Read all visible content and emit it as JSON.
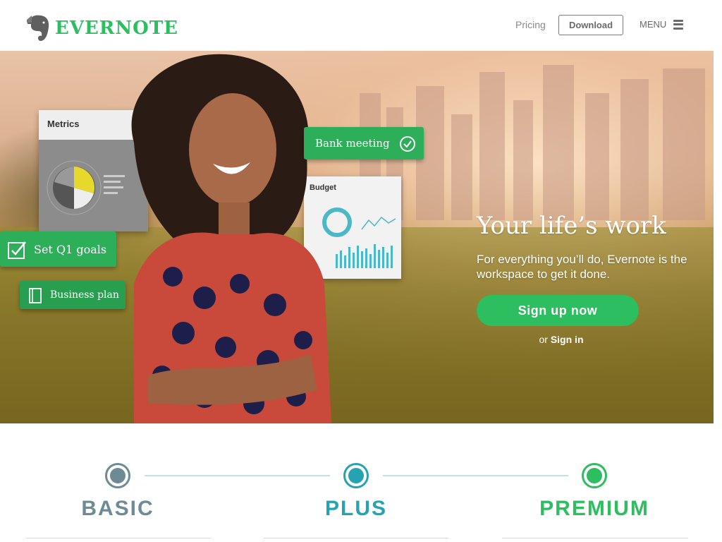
{
  "header": {
    "logo_text": "EVERNOTE",
    "pricing_label": "Pricing",
    "download_label": "Download",
    "menu_label": "MENU"
  },
  "hero": {
    "title": "Your life’s work",
    "subtitle": "For everything you’ll do, Evernote is the workspace to get it done.",
    "signup_label": "Sign up now",
    "signin_prefix": "or",
    "signin_label": "Sign in"
  },
  "cards": {
    "metrics_title": "Metrics",
    "budget_title": "Budget",
    "bank_meeting": "Bank meeting",
    "set_goals": "Set Q1 goals",
    "business_plan": "Business plan"
  },
  "plans": [
    {
      "name": "BASIC",
      "color": "#6e8a95"
    },
    {
      "name": "PLUS",
      "color": "#26a3b3"
    },
    {
      "name": "PREMIUM",
      "color": "#2dbe60"
    }
  ],
  "colors": {
    "brand_green": "#2dbe60",
    "text_gray": "#6a6a6a"
  }
}
